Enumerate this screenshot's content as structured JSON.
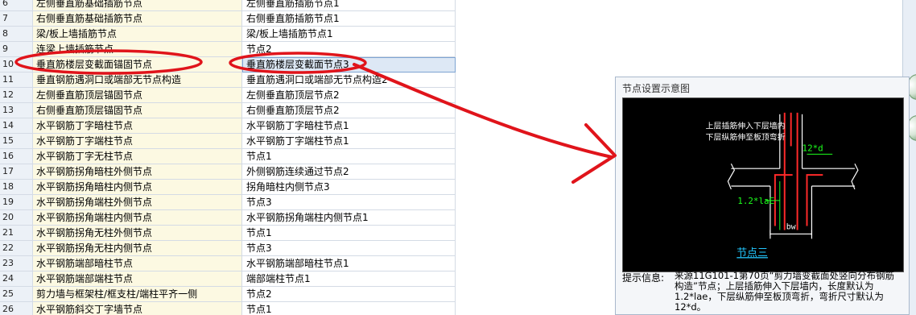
{
  "table": {
    "rows": [
      {
        "num": "6",
        "name": "左侧垂直筋基础插筋节点",
        "value": "左侧垂直筋插筋节点1"
      },
      {
        "num": "7",
        "name": "右侧垂直筋基础插筋节点",
        "value": "右侧垂直筋插筋节点1"
      },
      {
        "num": "8",
        "name": "梁/板上墙插筋节点",
        "value": "梁/板上墙插筋节点1"
      },
      {
        "num": "9",
        "name": "连梁上墙插筋节点",
        "value": "节点2"
      },
      {
        "num": "10",
        "name": "垂直筋楼层变截面锚固节点",
        "value": "垂直筋楼层变截面节点3"
      },
      {
        "num": "11",
        "name": "垂直钢筋遇洞口或端部无节点构造",
        "value": "垂直筋遇洞口或端部无节点构造2"
      },
      {
        "num": "12",
        "name": "左侧垂直筋顶层锚固节点",
        "value": "左侧垂直筋顶层节点2"
      },
      {
        "num": "13",
        "name": "右侧垂直筋顶层锚固节点",
        "value": "右侧垂直筋顶层节点2"
      },
      {
        "num": "14",
        "name": "水平钢筋丁字暗柱节点",
        "value": "水平钢筋丁字暗柱节点1"
      },
      {
        "num": "15",
        "name": "水平钢筋丁字端柱节点",
        "value": "水平钢筋丁字端柱节点1"
      },
      {
        "num": "16",
        "name": "水平钢筋丁字无柱节点",
        "value": "节点1"
      },
      {
        "num": "17",
        "name": "水平钢筋拐角暗柱外侧节点",
        "value": "外侧钢筋连续通过节点2"
      },
      {
        "num": "18",
        "name": "水平钢筋拐角暗柱内侧节点",
        "value": "拐角暗柱内侧节点3"
      },
      {
        "num": "19",
        "name": "水平钢筋拐角端柱外侧节点",
        "value": "节点3"
      },
      {
        "num": "20",
        "name": "水平钢筋拐角端柱内侧节点",
        "value": "水平钢筋拐角端柱内侧节点1"
      },
      {
        "num": "21",
        "name": "水平钢筋拐角无柱外侧节点",
        "value": "节点1"
      },
      {
        "num": "22",
        "name": "水平钢筋拐角无柱内侧节点",
        "value": "节点3"
      },
      {
        "num": "23",
        "name": "水平钢筋端部暗柱节点",
        "value": "水平钢筋端部暗柱节点1"
      },
      {
        "num": "24",
        "name": "水平钢筋端部端柱节点",
        "value": "端部端柱节点1"
      },
      {
        "num": "25",
        "name": "剪力墙与框架柱/框支柱/端柱平齐一侧",
        "value": "节点2"
      },
      {
        "num": "26",
        "name": "水平钢筋斜交丁字墙节点",
        "value": "节点1"
      }
    ],
    "selected_row": "10"
  },
  "panel": {
    "title": "节点设置示意图",
    "diagram": {
      "note_line1": "上层插筋伸入下层墙内",
      "note_line2": "下层纵筋伸至板顶弯折",
      "dim_12d": "12*d",
      "dim_lae": "1.2*laE",
      "dim_bw": "bw",
      "caption": "节点三"
    },
    "hint_label": "提示信息:",
    "hint_text": "来源11G101-1第70页“剪力墙变截面处竖向分布钢筋构造”节点；上层插筋伸入下层墙内，长度默认为1.2*lae，下层纵筋伸至板顶弯折，弯折尺寸默认为12*d。"
  },
  "colors": {
    "annotation": "#e0141b",
    "rebar": "#ff2a2a",
    "dimension": "#1cff1c",
    "caption": "#22c7ff"
  }
}
